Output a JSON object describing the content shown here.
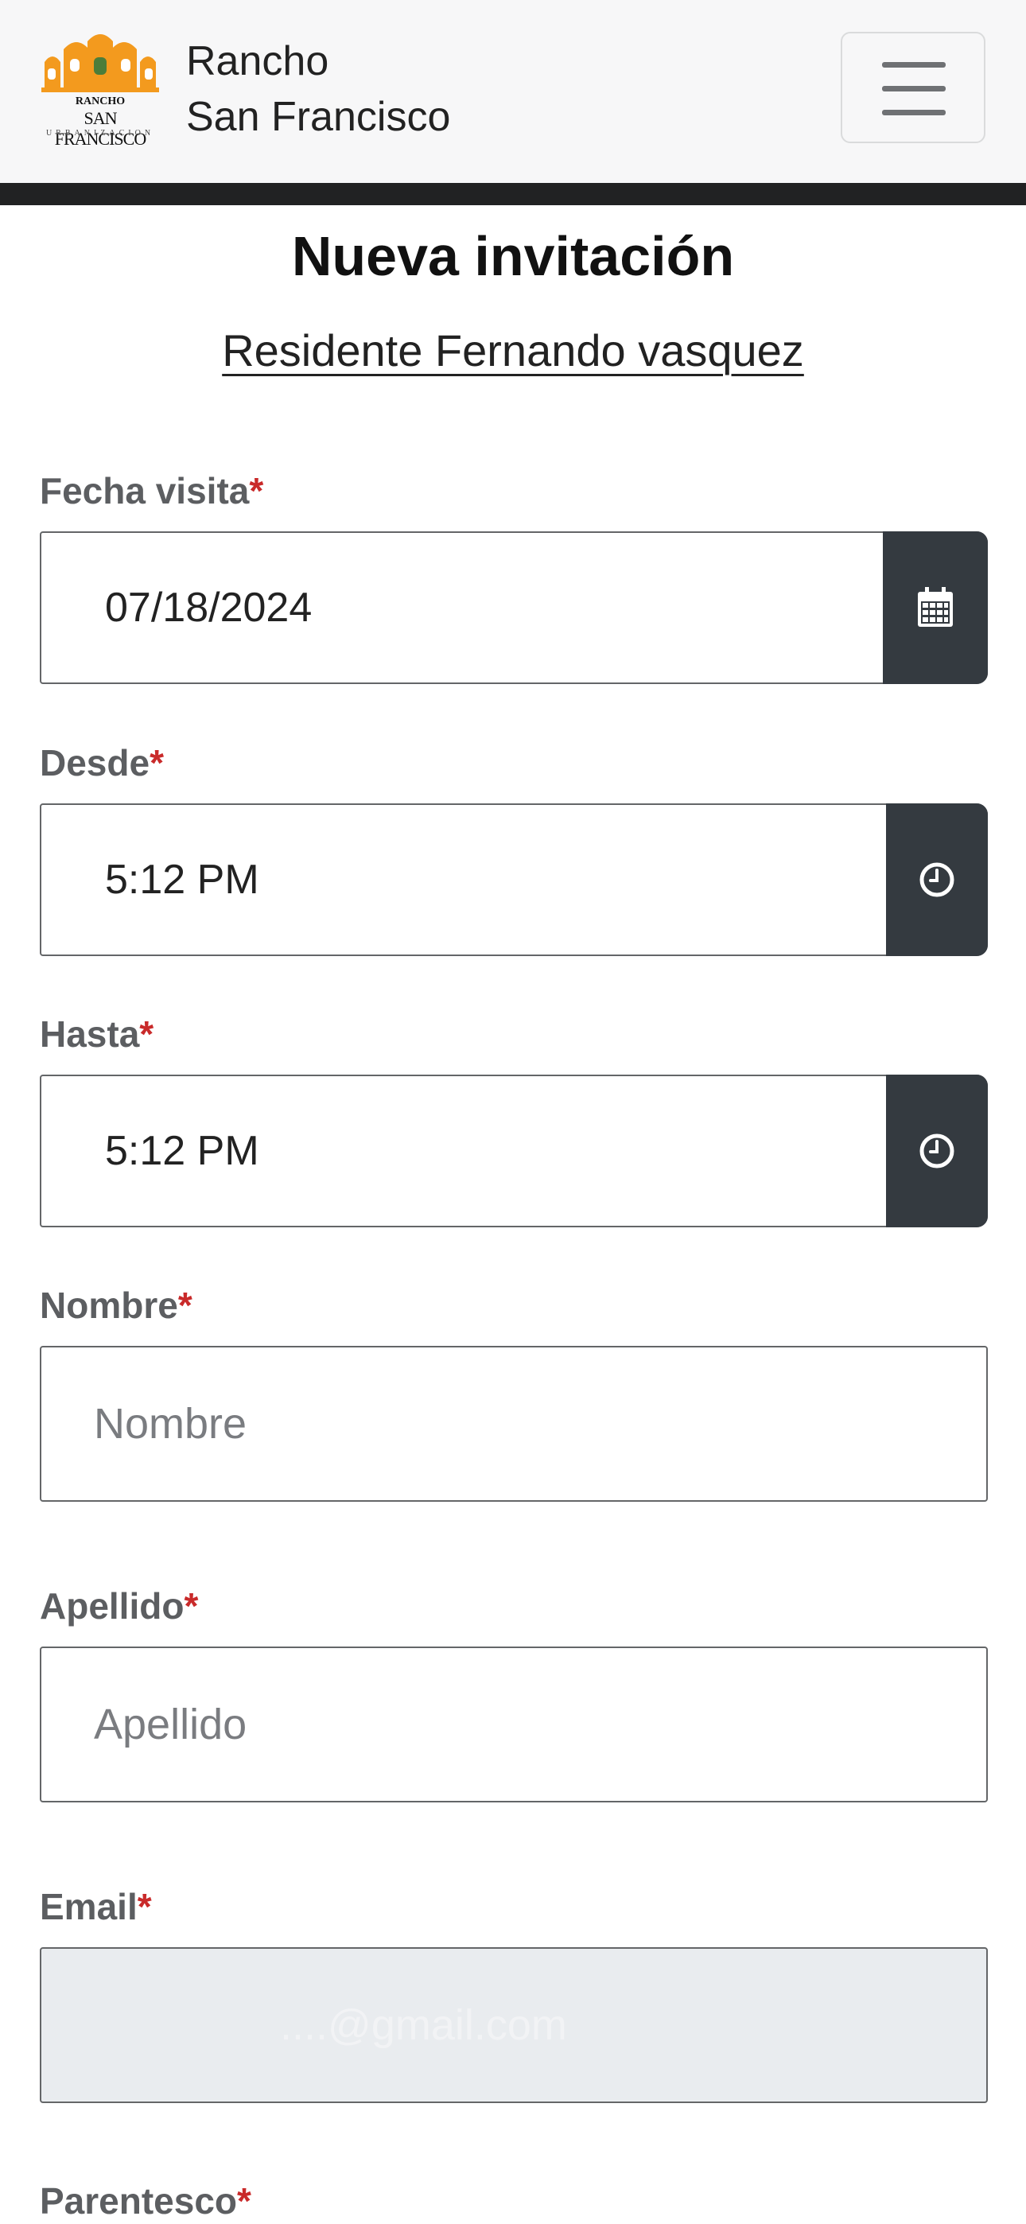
{
  "header": {
    "brand_line1": "Rancho",
    "brand_line2": "San Francisco",
    "logo_line1": "RANCHO",
    "logo_line2": "SAN FRANCISCO",
    "logo_line3": "URBANIZACION",
    "menu_icon": "hamburger-icon"
  },
  "page": {
    "title": "Nueva invitación",
    "subtitle": "Residente Fernando vasquez"
  },
  "form": {
    "required_mark": "*",
    "fecha": {
      "label": "Fecha visita",
      "value": "07/18/2024",
      "icon": "calendar-icon"
    },
    "desde": {
      "label": "Desde",
      "value": "5:12 PM",
      "icon": "clock-icon"
    },
    "hasta": {
      "label": "Hasta",
      "value": "5:12 PM",
      "icon": "clock-icon"
    },
    "nombre": {
      "label": "Nombre",
      "placeholder": "Nombre"
    },
    "apellido": {
      "label": "Apellido",
      "placeholder": "Apellido"
    },
    "email": {
      "label": "Email",
      "value": "....@gmail.com"
    },
    "next_label": "Parentesco"
  },
  "colors": {
    "accent_dark": "#343a40",
    "required": "#c92a2a",
    "logo_orange": "#f39a1e"
  }
}
